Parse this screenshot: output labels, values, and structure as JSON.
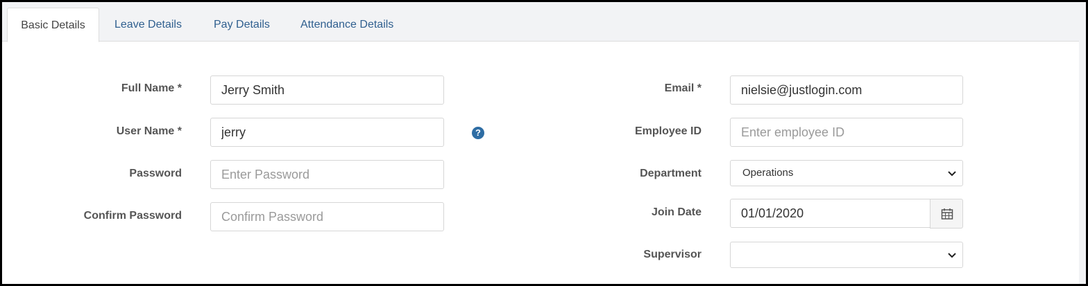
{
  "tabs": [
    {
      "label": "Basic Details",
      "active": true
    },
    {
      "label": "Leave Details",
      "active": false
    },
    {
      "label": "Pay Details",
      "active": false
    },
    {
      "label": "Attendance Details",
      "active": false
    }
  ],
  "form": {
    "full_name": {
      "label": "Full Name *",
      "value": "Jerry Smith"
    },
    "user_name": {
      "label": "User Name *",
      "value": "jerry"
    },
    "password": {
      "label": "Password",
      "placeholder": "Enter Password"
    },
    "confirm_password": {
      "label": "Confirm Password",
      "placeholder": "Confirm Password"
    },
    "email": {
      "label": "Email *",
      "value": "nielsie@justlogin.com"
    },
    "employee_id": {
      "label": "Employee ID",
      "placeholder": "Enter employee ID"
    },
    "department": {
      "label": "Department",
      "value": "Operations"
    },
    "join_date": {
      "label": "Join Date",
      "value": "01/01/2020"
    },
    "supervisor": {
      "label": "Supervisor",
      "value": ""
    }
  },
  "icons": {
    "help": "question-circle-icon",
    "calendar": "calendar-icon",
    "chevron": "chevron-down-icon"
  },
  "colors": {
    "tab_link": "#2f5f8f",
    "help_icon": "#2e6da4"
  }
}
